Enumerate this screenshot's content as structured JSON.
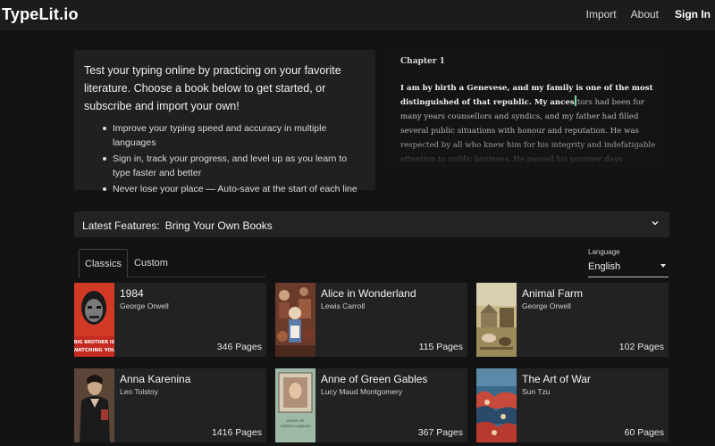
{
  "header": {
    "brand": "TypeLit.io",
    "nav": {
      "import": "Import",
      "about": "About",
      "sign_in": "Sign In"
    }
  },
  "intro": {
    "lead": "Test your typing online by practicing on your favorite literature. Choose a book below to get started, or subscribe and import your own!",
    "bullets": [
      "Improve your typing speed and accuracy in multiple languages",
      "Sign in, track your progress, and level up as you learn to type faster and better",
      "Never lose your place — Auto-save at the start of each line"
    ]
  },
  "sample": {
    "chapter": "Chapter 1",
    "typed": "I am by birth a Genevese, and my family is one of the most distinguished of that republic. My ances",
    "remaining": "tors had been for many years counsellors and syndics, and my father had filled several public situations with honour and reputation. He was respected by all who knew him for his integrity and indefatigable attention to public business. He passed his younger days perpetually occupied by the"
  },
  "features": {
    "label": "Latest Features:",
    "value": "Bring Your Own Books"
  },
  "tabs": {
    "classics": "Classics",
    "custom": "Custom"
  },
  "language": {
    "label": "Language",
    "value": "English"
  },
  "books": [
    {
      "title": "1984",
      "author": "George Orwell",
      "pages": "346 Pages"
    },
    {
      "title": "Alice in Wonderland",
      "author": "Lewis Carroll",
      "pages": "115 Pages"
    },
    {
      "title": "Animal Farm",
      "author": "George Orwell",
      "pages": "102 Pages"
    },
    {
      "title": "Anna Karenina",
      "author": "Leo Tolstoy",
      "pages": "1416 Pages"
    },
    {
      "title": "Anne of Green Gables",
      "author": "Lucy Maud Montgomery",
      "pages": "367 Pages"
    },
    {
      "title": "The Art of War",
      "author": "Sun Tzu",
      "pages": "60 Pages"
    }
  ],
  "covers": {
    "cover_1984_text": "BIG BROTHER IS WATCHING YOU",
    "cover_anne_text": "ANNE OF GREEN GABLES"
  },
  "colors": {
    "background": "#131313",
    "panel": "#202020",
    "card": "#222222",
    "cursor": "#7bd0a4"
  }
}
